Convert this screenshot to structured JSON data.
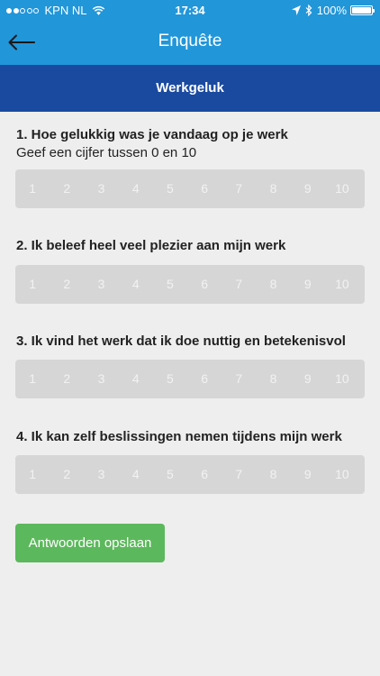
{
  "status_bar": {
    "carrier": "KPN NL",
    "time": "17:34",
    "battery": "100%",
    "icons": [
      "signal-dots-icon",
      "wifi-icon",
      "location-icon",
      "bluetooth-icon",
      "battery-icon"
    ]
  },
  "nav": {
    "back_icon": "arrow-left-icon",
    "title": "Enquête"
  },
  "section": {
    "title": "Werkgeluk"
  },
  "questions": [
    {
      "title": "1. Hoe gelukkig was je vandaag op je werk",
      "subtitle": "Geef een cijfer tussen 0 en 10"
    },
    {
      "title": "2. Ik beleef heel veel plezier aan mijn werk",
      "subtitle": ""
    },
    {
      "title": "3. Ik vind het werk dat ik doe nuttig en betekenisvol",
      "subtitle": ""
    },
    {
      "title": "4. Ik kan zelf beslissingen nemen tijdens mijn werk",
      "subtitle": ""
    }
  ],
  "scale": [
    "1",
    "2",
    "3",
    "4",
    "5",
    "6",
    "7",
    "8",
    "9",
    "10"
  ],
  "save_label": "Antwoorden opslaan",
  "colors": {
    "nav_blue": "#2196d9",
    "section_blue": "#1a4aa0",
    "save_green": "#5cb85c",
    "scale_bg": "#d6d6d6"
  }
}
